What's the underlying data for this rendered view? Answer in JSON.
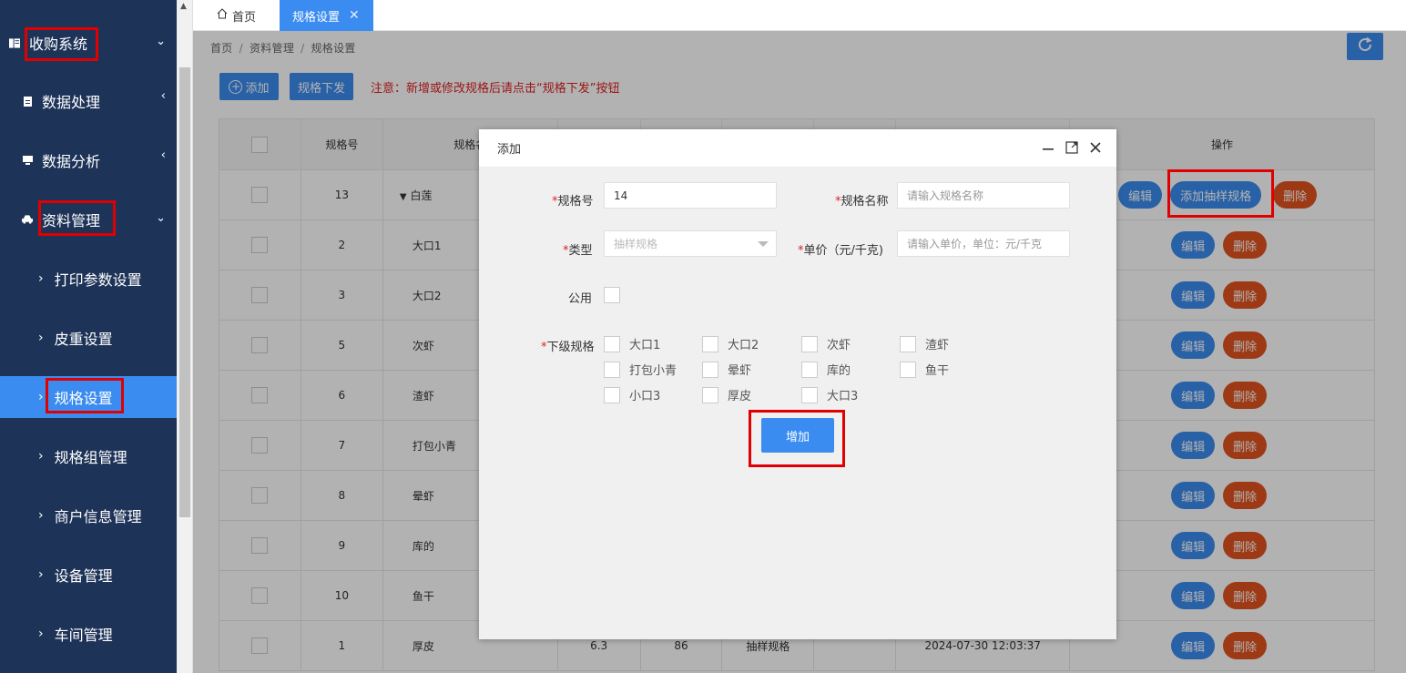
{
  "sidebar": {
    "system": {
      "label": "收购系统"
    },
    "groups": [
      {
        "label": "数据处理"
      },
      {
        "label": "数据分析"
      },
      {
        "label": "资料管理"
      }
    ],
    "subitems": [
      {
        "label": "打印参数设置"
      },
      {
        "label": "皮重设置"
      },
      {
        "label": "规格设置"
      },
      {
        "label": "规格组管理"
      },
      {
        "label": "商户信息管理"
      },
      {
        "label": "设备管理"
      },
      {
        "label": "车间管理"
      }
    ]
  },
  "tabs": {
    "home": "首页",
    "current": "规格设置",
    "close": "✕"
  },
  "breadcrumb": {
    "items": [
      "首页",
      "资料管理",
      "规格设置"
    ],
    "sep": "/"
  },
  "toolbar": {
    "add_label": "添加",
    "push_label": "规格下发",
    "notice": "注意：新增或修改规格后请点击“规格下发”按钮"
  },
  "table": {
    "headers": {
      "code": "规格号",
      "name": "规格名",
      "op": "操作"
    },
    "rows": [
      {
        "code": "13",
        "name": "白莲",
        "expand": "▼"
      },
      {
        "code": "2",
        "name": "大口1"
      },
      {
        "code": "3",
        "name": "大口2"
      },
      {
        "code": "5",
        "name": "次虾"
      },
      {
        "code": "6",
        "name": "渣虾"
      },
      {
        "code": "7",
        "name": "打包小青"
      },
      {
        "code": "8",
        "name": "晕虾"
      },
      {
        "code": "9",
        "name": "库的"
      },
      {
        "code": "10",
        "name": "鱼干"
      },
      {
        "code": "1",
        "name": "厚皮",
        "c3": "6.3",
        "c4": "86",
        "c5": "抽样规格",
        "c7": "2024-07-30 12:03:37"
      }
    ],
    "actions": {
      "edit": "编辑",
      "add_sample": "添加抽样规格",
      "delete": "删除"
    }
  },
  "dialog": {
    "title": "添加",
    "fields": {
      "code_label": "规格号",
      "code_value": "14",
      "name_label": "规格名称",
      "name_placeholder": "请输入规格名称",
      "type_label": "类型",
      "type_value": "抽样规格",
      "price_label": "单价（元/千克)",
      "price_placeholder": "请输入单价，单位：元/千克",
      "public_label": "公用",
      "sub_label": "下级规格",
      "required_mark": "*"
    },
    "sub_specs": [
      "大口1",
      "大口2",
      "次虾",
      "渣虾",
      "打包小青",
      "晕虾",
      "库的",
      "鱼干",
      "小口3",
      "厚皮",
      "大口3"
    ],
    "submit_label": "增加"
  },
  "colors": {
    "sidebar_bg": "#1e3358",
    "accent": "#3b8cf0",
    "danger": "#e1531f",
    "annotation": "#e00000"
  }
}
